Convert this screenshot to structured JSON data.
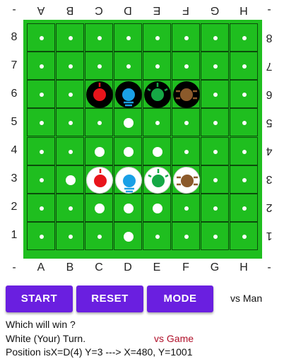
{
  "board": {
    "columns": [
      "A",
      "B",
      "C",
      "D",
      "E",
      "F",
      "G",
      "H"
    ],
    "rows": [
      "8",
      "7",
      "6",
      "5",
      "4",
      "3",
      "2",
      "1"
    ],
    "corner_mark": "-",
    "board_color": "#1fbe1f",
    "pieces": [
      {
        "cell": "C6",
        "color": "black",
        "player": "red"
      },
      {
        "cell": "D6",
        "color": "black",
        "player": "blue"
      },
      {
        "cell": "E6",
        "color": "black",
        "player": "green"
      },
      {
        "cell": "F6",
        "color": "black",
        "player": "brown"
      },
      {
        "cell": "C3",
        "color": "white",
        "player": "red"
      },
      {
        "cell": "D3",
        "color": "white",
        "player": "blue"
      },
      {
        "cell": "E3",
        "color": "white",
        "player": "green"
      },
      {
        "cell": "F3",
        "color": "white",
        "player": "brown"
      }
    ],
    "hint_dots": [
      "D5",
      "C4",
      "D4",
      "E4",
      "B3",
      "C2",
      "D2",
      "E2",
      "D1"
    ],
    "player_colors": {
      "red": "#e8141b",
      "blue": "#1aa0e6",
      "green": "#15a845",
      "brown": "#8b5a2b"
    }
  },
  "buttons": {
    "start": "START",
    "reset": "RESET",
    "mode": "MODE",
    "button_color": "#6a1fe0"
  },
  "mode_text": "vs Man",
  "status": {
    "line1": "Which will win ?",
    "line2": "White (Your) Turn.",
    "line2_mode": "vs Game",
    "line3": "Position isX=D(4)  Y=3 --->   X=480, Y=1001",
    "mode_color": "#b0102a"
  }
}
